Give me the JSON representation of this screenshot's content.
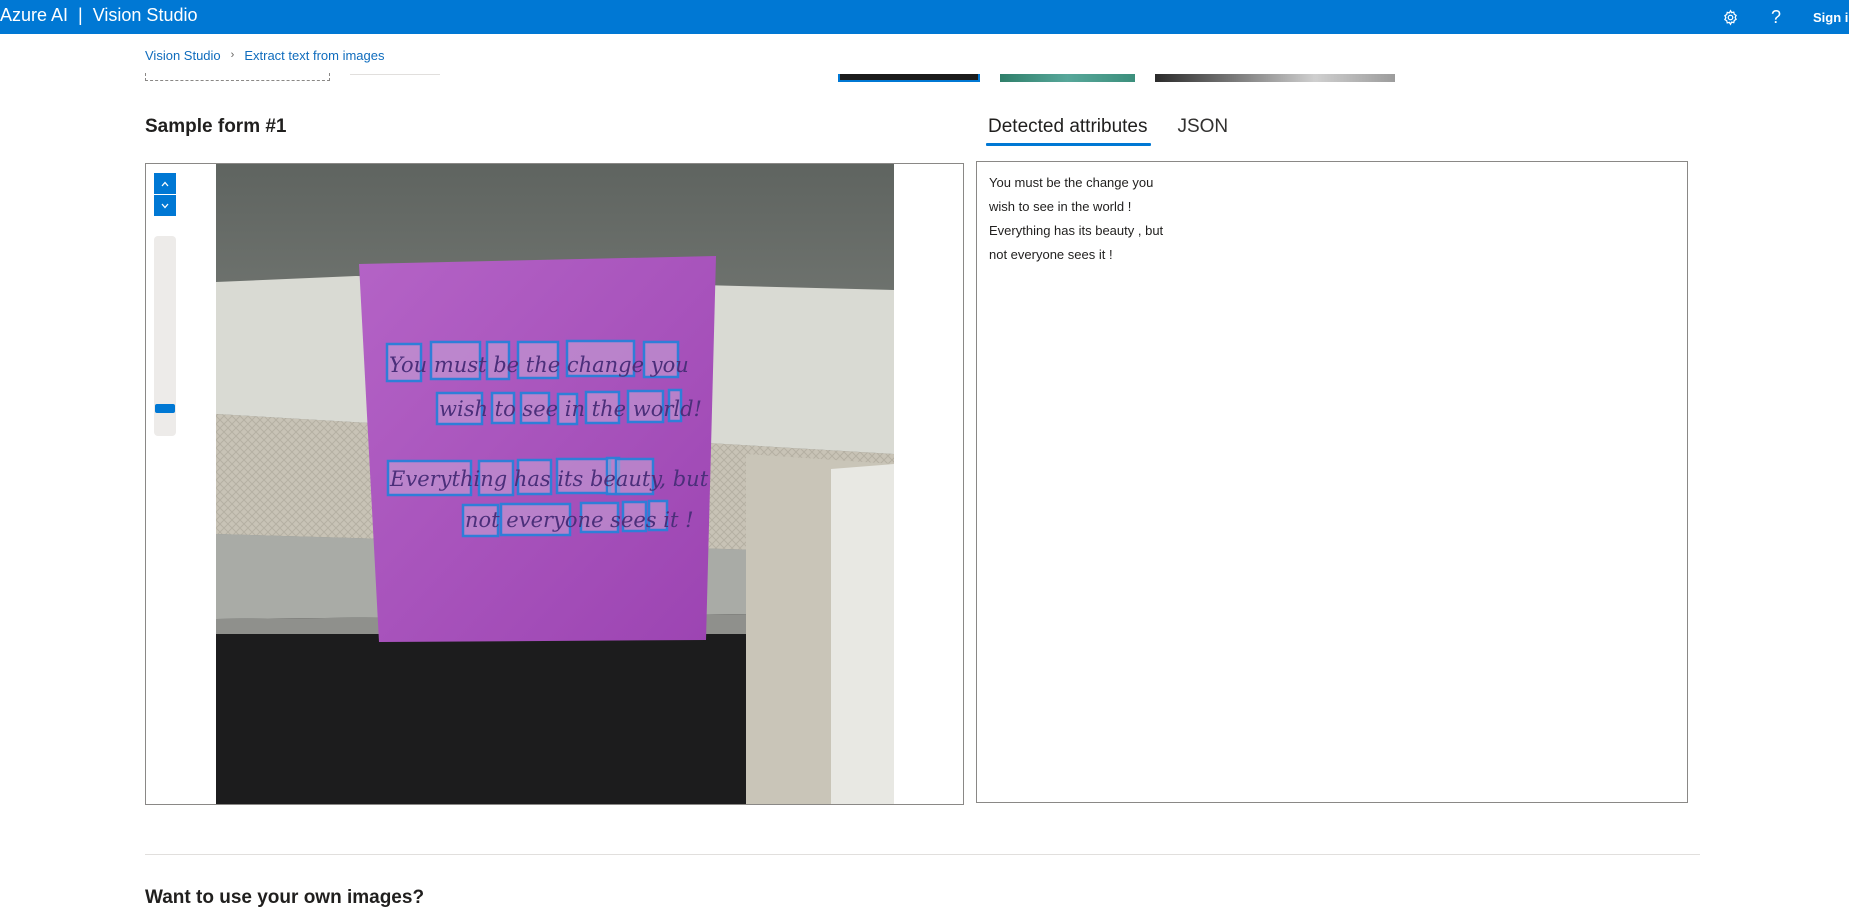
{
  "header": {
    "brand_left": "Azure AI",
    "brand_separator": "|",
    "brand_right": "Vision Studio",
    "settings_icon": "gear-icon",
    "help_label": "?",
    "sign_in": "Sign in"
  },
  "breadcrumb": {
    "items": [
      "Vision Studio",
      "Extract text from images"
    ],
    "separator": "›"
  },
  "sample": {
    "title": "Sample form #1",
    "zoom_in_icon": "chevron-up-icon",
    "zoom_out_icon": "chevron-down-icon",
    "zoom_level_fraction": 0.12
  },
  "tabs": [
    {
      "label": "Detected attributes",
      "active": true
    },
    {
      "label": "JSON",
      "active": false
    }
  ],
  "results": {
    "lines": [
      "You must be the change you",
      "wish to see in the world !",
      "Everything has its beauty , but",
      "not everyone sees it !"
    ]
  },
  "image_note": {
    "words_row1": [
      "You",
      "must",
      "be",
      "the",
      "change",
      "you"
    ],
    "words_row2": [
      "wish",
      "to",
      "see",
      "in",
      "the",
      "world",
      "!"
    ],
    "words_row3": [
      "Everything",
      "has",
      "its",
      "beauty",
      ",",
      "but"
    ],
    "words_row4": [
      "not",
      "everyone",
      "sees",
      "it",
      "!"
    ]
  },
  "bottom": {
    "title": "Want to use your own images?"
  },
  "colors": {
    "brand": "#0078d4",
    "note_purple": "#a14bb8",
    "box_blue": "#2f7ed8"
  }
}
